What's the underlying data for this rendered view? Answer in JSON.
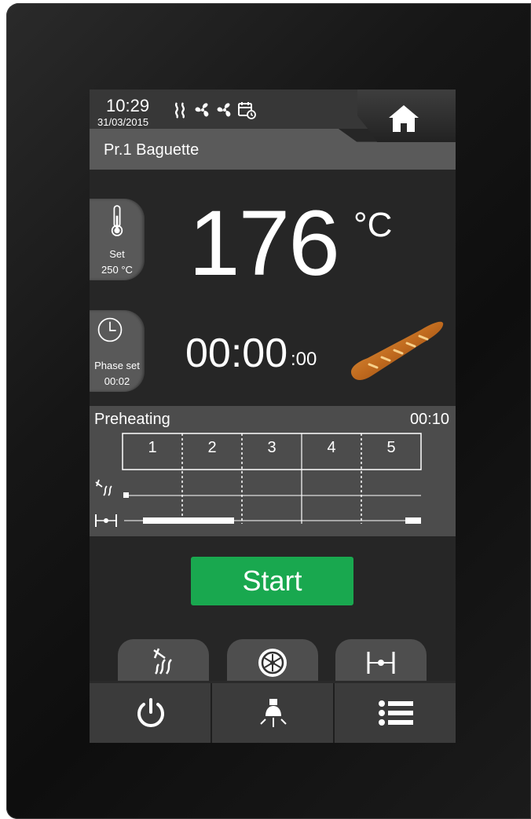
{
  "status": {
    "time": "10:29",
    "date": "31/03/2015"
  },
  "program": {
    "name": "Pr.1 Baguette"
  },
  "temperature": {
    "current": "176",
    "unit": "°C",
    "set_label": "Set",
    "set_value": "250 °C"
  },
  "timer": {
    "main": "00:00",
    "sub": ":00",
    "phase_label": "Phase set",
    "phase_value": "00:02"
  },
  "phases": {
    "title": "Preheating",
    "time": "00:10",
    "steps": [
      "1",
      "2",
      "3",
      "4",
      "5"
    ]
  },
  "start": {
    "label": "Start"
  },
  "icons": {
    "status": [
      "heat-waves-icon",
      "fan-icon",
      "fan-icon",
      "calendar-clock-icon"
    ],
    "home": "home-icon",
    "function_tabs": [
      "steam-injection-icon",
      "fan-speed-icon",
      "damper-icon"
    ],
    "bottom": [
      "power-icon",
      "oven-light-icon",
      "menu-list-icon"
    ]
  },
  "colors": {
    "start": "#19a84f",
    "screen": "#262626",
    "panel": "#4c4c4c"
  }
}
